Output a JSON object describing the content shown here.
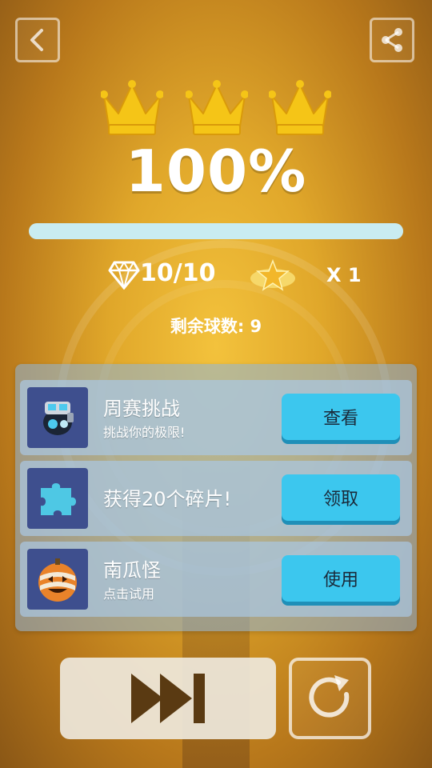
{
  "top_bar": {
    "back_icon": "back-arrow-icon",
    "share_icon": "share-icon"
  },
  "result": {
    "crowns_earned": 3,
    "crowns_total": 3,
    "percent_label": "100%",
    "progress_fraction": 1.0
  },
  "stats": {
    "gems_label": "10/10",
    "gem_icon": "diamond-icon",
    "star_icon": "star-icon",
    "star_multiplier_label": "X 1",
    "remaining_balls_label": "剩余球数: 9"
  },
  "offers": [
    {
      "icon": "robot-ball-icon",
      "title": "周赛挑战",
      "subtitle": "挑战你的极限!",
      "button": "查看"
    },
    {
      "icon": "puzzle-piece-icon",
      "title": "获得20个碎片!",
      "subtitle": "",
      "button": "领取"
    },
    {
      "icon": "pumpkin-ball-icon",
      "title": "南瓜怪",
      "subtitle": "点击试用",
      "button": "使用"
    }
  ],
  "bottom": {
    "skip_icon": "fast-forward-icon",
    "replay_icon": "replay-icon"
  },
  "colors": {
    "accent_button": "#3cc7ee",
    "crown_gold": "#f5c517",
    "progress_fill": "#c9ecf1"
  }
}
